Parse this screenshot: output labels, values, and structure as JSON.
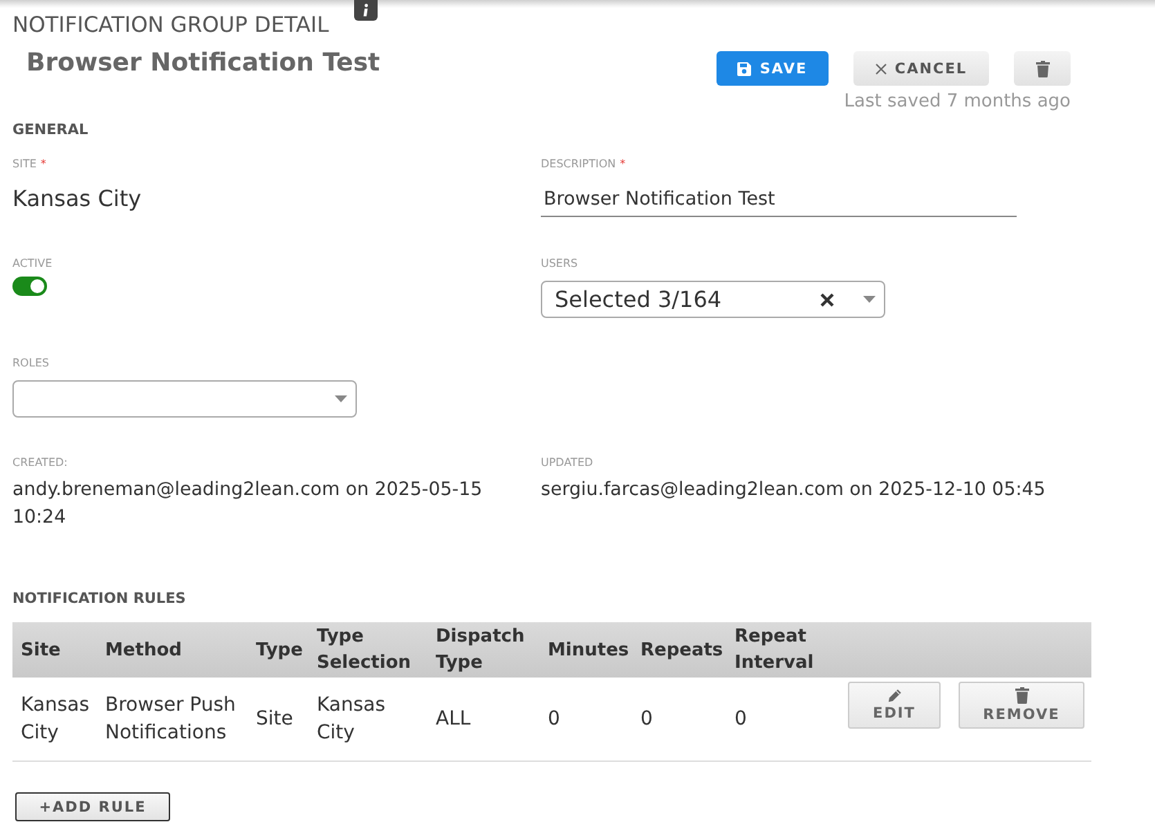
{
  "page": {
    "title": "NOTIFICATION GROUP DETAIL",
    "name": "Browser Notification Test"
  },
  "actions": [
    {
      "kind": "save",
      "label": "SAVE"
    },
    {
      "kind": "cancel",
      "label": "CANCEL"
    },
    {
      "kind": "delete"
    }
  ],
  "last_saved": "Last saved 7 months ago",
  "general": {
    "heading": "GENERAL",
    "rows": [
      [
        {
          "kind": "text",
          "label": "SITE",
          "required_mark": "*",
          "value": "Kansas City"
        },
        {
          "kind": "input",
          "label": "DESCRIPTION",
          "required_mark": "*",
          "value": "Browser Notification Test"
        }
      ],
      [
        {
          "kind": "toggle",
          "label": "ACTIVE",
          "on": true
        },
        {
          "kind": "select",
          "label": "USERS",
          "value": "Selected 3/164",
          "clearable": true
        }
      ],
      [
        {
          "kind": "select",
          "label": "ROLES",
          "clearable": false
        }
      ],
      [
        {
          "kind": "meta",
          "label": "CREATED:",
          "value": "andy.breneman@leading2lean.com on 2025-05-15 10:24"
        },
        {
          "kind": "meta",
          "label": "UPDATED",
          "value": "sergiu.farcas@leading2lean.com on 2025-12-10 05:45"
        }
      ]
    ]
  },
  "rules": {
    "heading": "NOTIFICATION RULES",
    "columns": [
      "Site",
      "Method",
      "Type",
      "Type Selection",
      "Dispatch Type",
      "Minutes",
      "Repeats",
      "Repeat Interval"
    ],
    "rows": [
      {
        "cells": [
          "Kansas City",
          "Browser Push Notifications",
          "Site",
          "Kansas City",
          "ALL",
          "0",
          "0",
          "0"
        ],
        "actions": [
          {
            "kind": "edit",
            "label": "EDIT"
          },
          {
            "kind": "remove",
            "label": "REMOVE"
          }
        ]
      }
    ],
    "add_button": "+ADD RULE"
  }
}
